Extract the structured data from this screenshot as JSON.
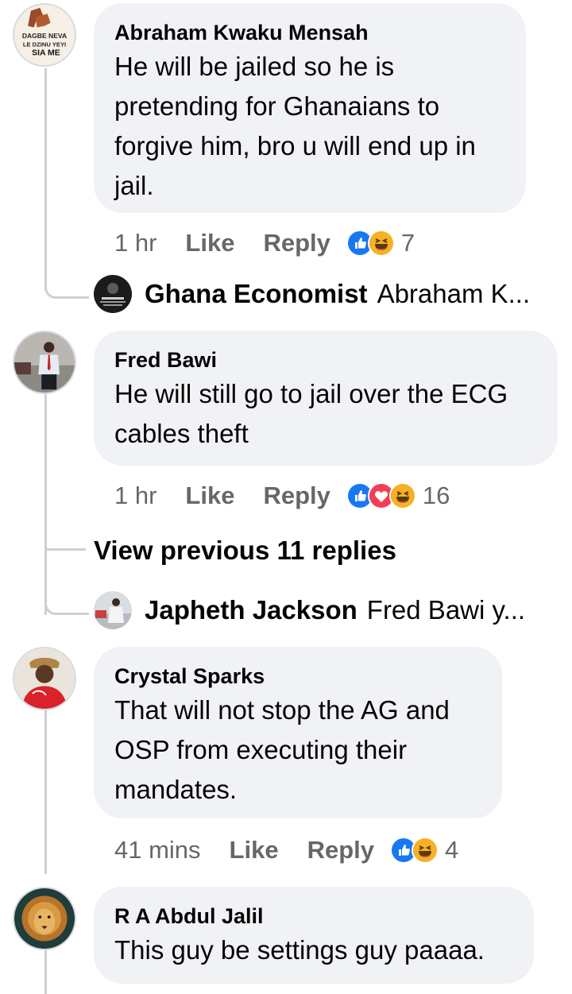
{
  "comments": [
    {
      "author": "Abraham Kwaku Mensah",
      "text_lines": [
        "He will be jailed so he is",
        "pretending for Ghanaians to",
        "forgive him, bro u will end up in",
        "jail."
      ],
      "avatar_text": [
        "DAGBE NEVA",
        "LE DZINU YEYI",
        "SIA ME"
      ],
      "time": "1 hr",
      "like": "Like",
      "reply": "Reply",
      "reactions": [
        "like-reaction",
        "haha-reaction"
      ],
      "reaction_count": "7",
      "reply_preview": {
        "author": "Ghana Economist",
        "text": "Abraham K..."
      }
    },
    {
      "author": "Fred Bawi",
      "text_lines": [
        "He will still go to jail over the ECG",
        "cables theft"
      ],
      "time": "1 hr",
      "like": "Like",
      "reply": "Reply",
      "reactions": [
        "like-reaction",
        "love-reaction",
        "haha-reaction"
      ],
      "reaction_count": "16",
      "view_previous": "View previous 11 replies",
      "reply_preview": {
        "author": "Japheth Jackson",
        "text": "Fred Bawi y..."
      }
    },
    {
      "author": "Crystal Sparks",
      "text_lines": [
        "That will not stop the AG and",
        "OSP from executing their",
        "mandates."
      ],
      "time": "41 mins",
      "like": "Like",
      "reply": "Reply",
      "reactions": [
        "like-reaction",
        "haha-reaction"
      ],
      "reaction_count": "4"
    },
    {
      "author": "R A Abdul Jalil",
      "text_lines": [
        "This guy be settings guy paaaa."
      ]
    }
  ],
  "colors": {
    "bubble_bg": "#f0f2f5",
    "meta_text": "#65676b",
    "thread_line": "#ccd0d5",
    "like_blue": "#1877f2",
    "love_red": "#f33e58",
    "haha_yellow": "#f7b125"
  }
}
